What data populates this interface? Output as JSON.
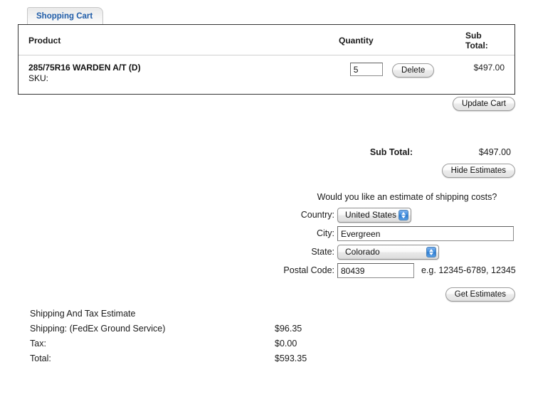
{
  "tab": {
    "label": "Shopping Cart"
  },
  "cart": {
    "headers": {
      "product": "Product",
      "quantity": "Quantity",
      "subtotal": "Sub Total:"
    },
    "items": [
      {
        "name": "285/75R16 WARDEN A/T (D)",
        "sku_label": "SKU:",
        "quantity": "5",
        "delete_label": "Delete",
        "subtotal": "$497.00"
      }
    ],
    "update_label": "Update Cart"
  },
  "totals": {
    "subtotal_label": "Sub Total:",
    "subtotal_value": "$497.00",
    "hide_estimates_label": "Hide Estimates"
  },
  "estimate": {
    "question": "Would you like an estimate of shipping costs?",
    "country_label": "Country:",
    "country_value": "United States",
    "city_label": "City:",
    "city_value": "Evergreen",
    "city_placeholder": "",
    "state_label": "State:",
    "state_value": "Colorado",
    "postal_label": "Postal Code:",
    "postal_value": "80439",
    "postal_placeholder": "",
    "postal_hint": "e.g. 12345-6789, 12345",
    "get_estimates_label": "Get Estimates"
  },
  "results": {
    "title": "Shipping And Tax Estimate",
    "rows": [
      {
        "label": "Shipping: (FedEx Ground Service)",
        "value": "$96.35"
      },
      {
        "label": "Tax:",
        "value": "$0.00"
      },
      {
        "label": "Total:",
        "value": "$593.35"
      }
    ]
  },
  "colors": {
    "tab_text": "#1f5ca8",
    "stepper_blue": "#3f8ede",
    "box_border": "#333333"
  }
}
